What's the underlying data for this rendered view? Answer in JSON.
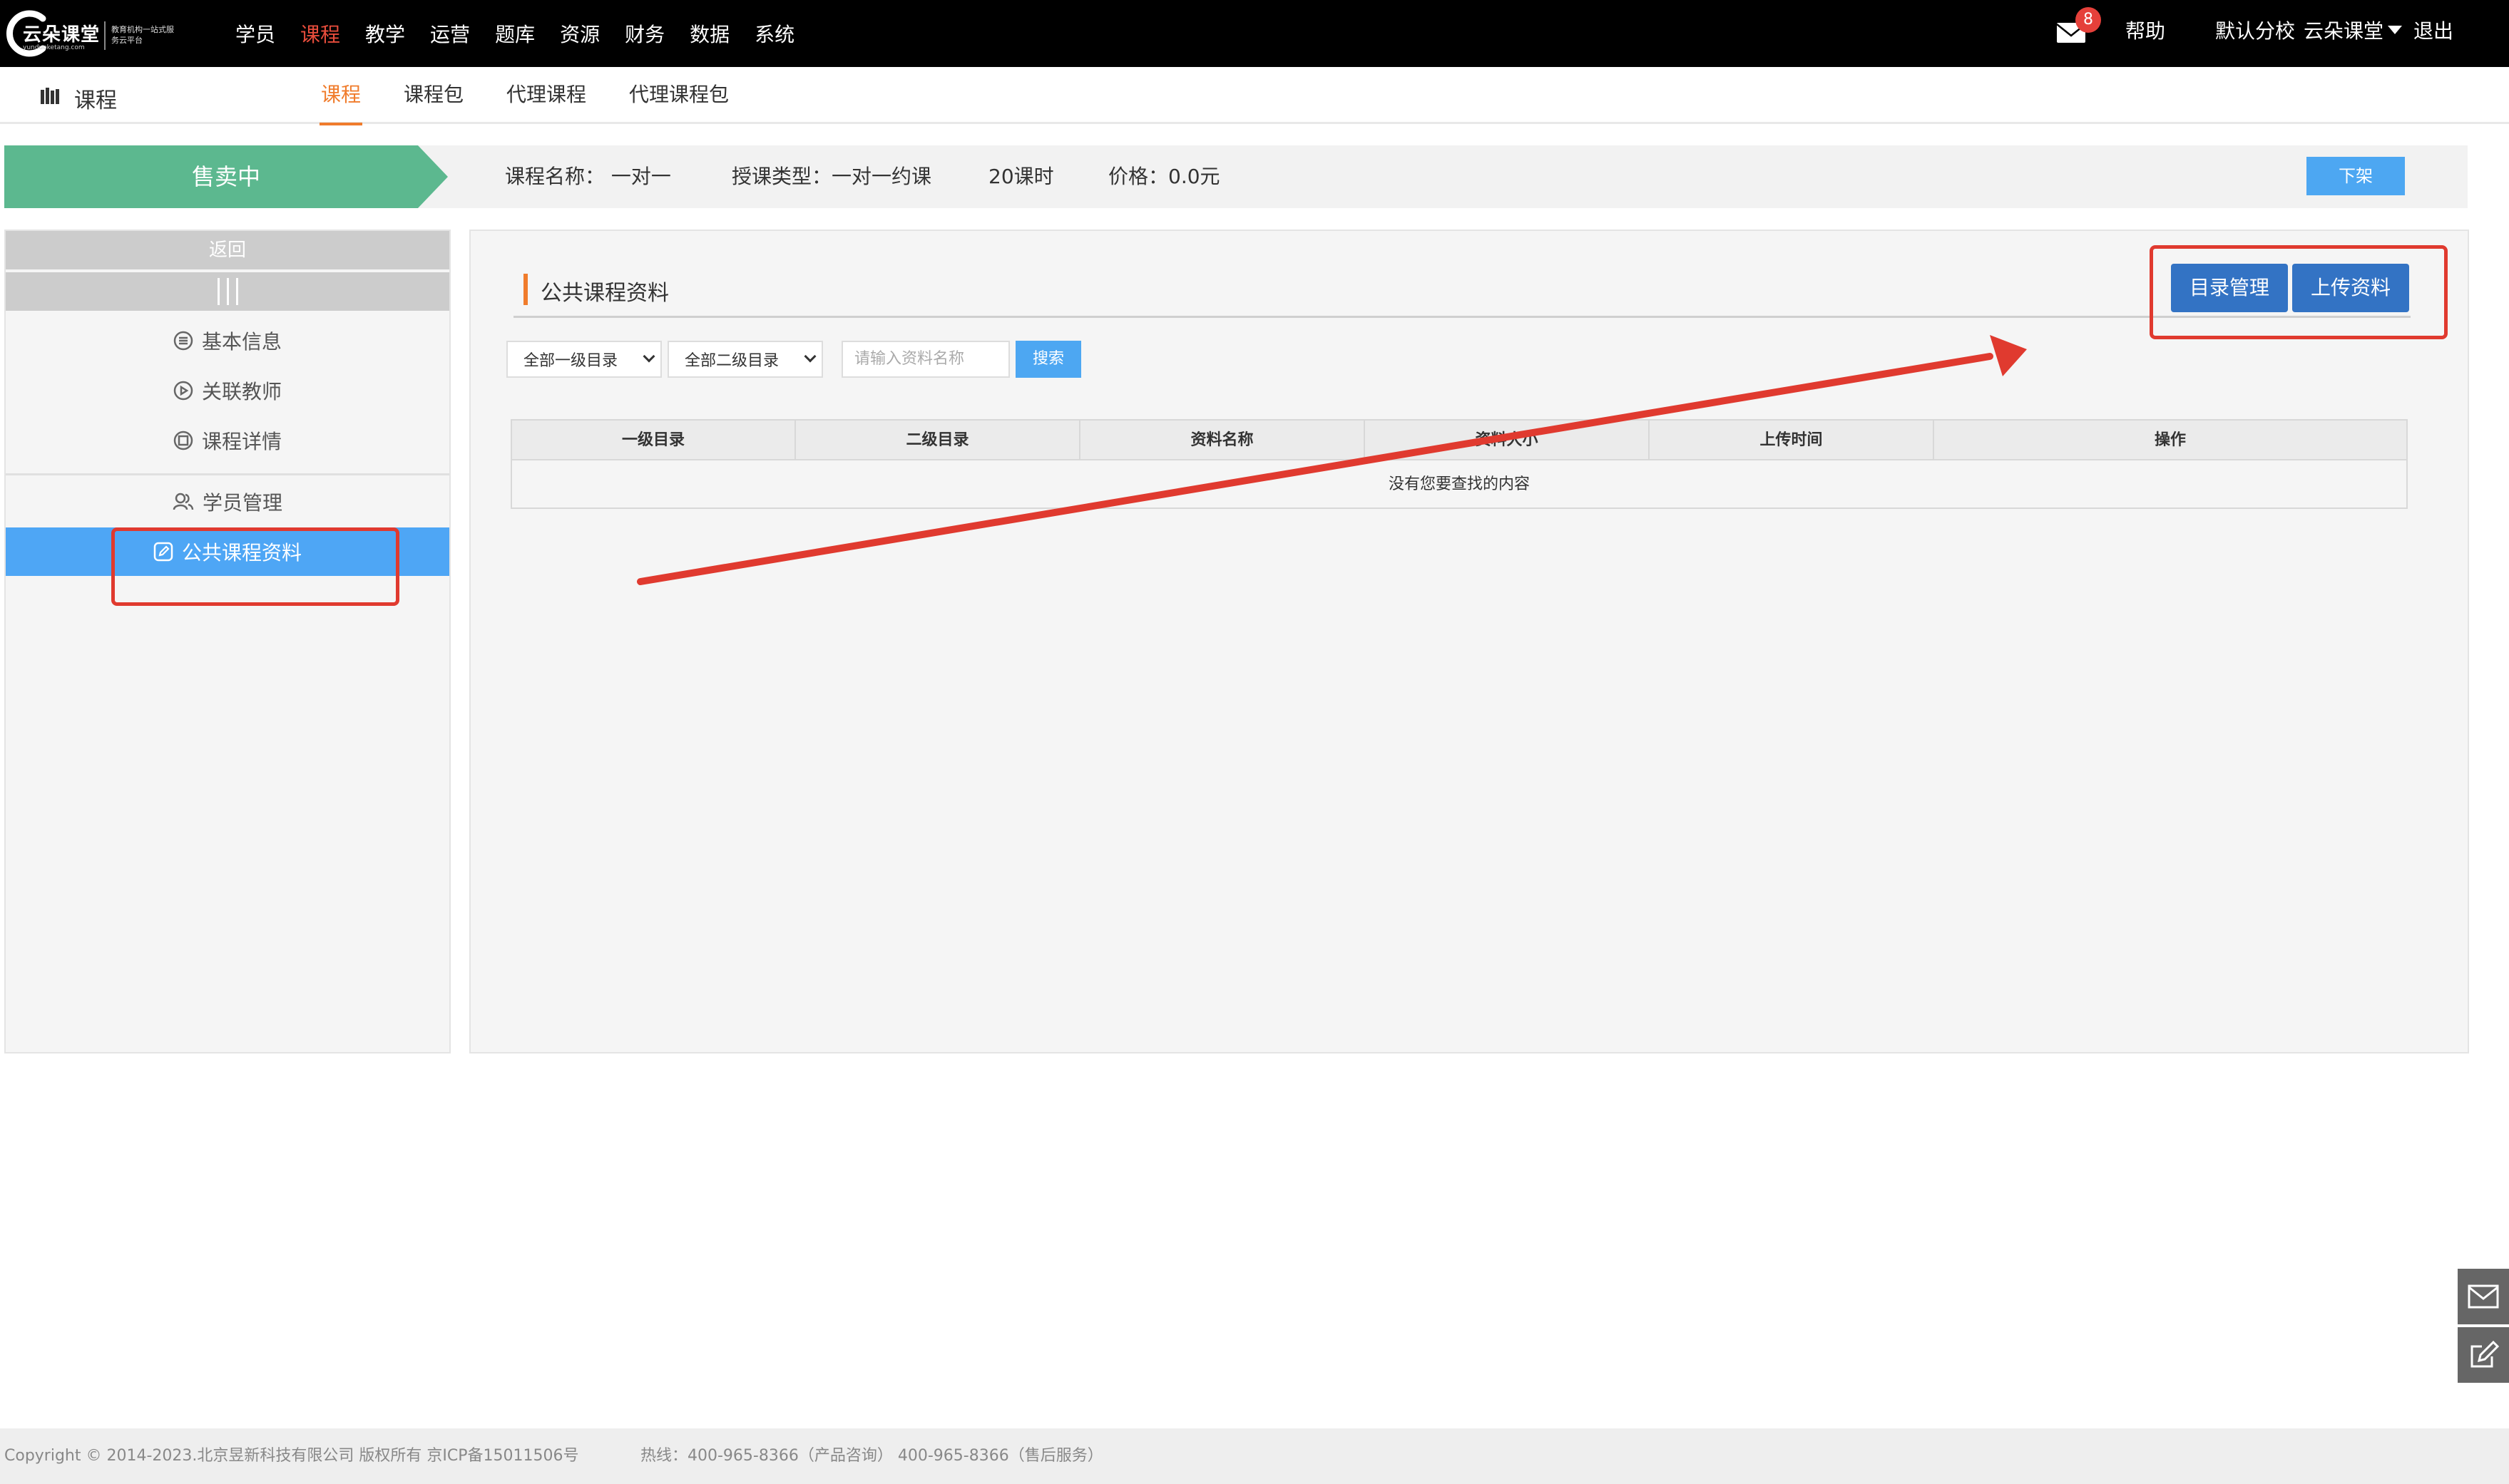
{
  "brand": {
    "name": "云朵课堂",
    "domain": "yunduoketang.com",
    "slogan": "教育机构一站式服务云平台"
  },
  "nav": {
    "items": [
      "学员",
      "课程",
      "教学",
      "运营",
      "题库",
      "资源",
      "财务",
      "数据",
      "系统"
    ],
    "active_index": 1
  },
  "header": {
    "mail_count": "8",
    "help_label": "帮助",
    "campus_label": "默认分校",
    "user_label": "云朵课堂",
    "logout_label": "退出"
  },
  "subheader": {
    "title": "课程",
    "tabs": [
      "课程",
      "课程包",
      "代理课程",
      "代理课程包"
    ],
    "active_tab": 0
  },
  "status": {
    "state_label": "售卖中",
    "course_name": "课程名称：  一对一",
    "teach_type": "授课类型：一对一约课",
    "hours": "20课时",
    "price": "价格：0.0元",
    "offshelf_label": "下架"
  },
  "sidebar": {
    "back_label": "返回",
    "items": [
      {
        "label": "基本信息",
        "icon": "list-icon"
      },
      {
        "label": "关联教师",
        "icon": "play-icon"
      },
      {
        "label": "课程详情",
        "icon": "detail-icon"
      },
      {
        "label": "学员管理",
        "icon": "users-icon"
      },
      {
        "label": "公共课程资料",
        "icon": "edit-icon",
        "active": true
      }
    ]
  },
  "main": {
    "section_title": "公共课程资料",
    "dir_manage_label": "目录管理",
    "upload_label": "上传资料",
    "filter": {
      "level1_value": "全部一级目录",
      "level2_value": "全部二级目录",
      "search_placeholder": "请输入资料名称",
      "search_label": "搜索"
    },
    "table": {
      "columns": [
        "一级目录",
        "二级目录",
        "资料名称",
        "资料大小",
        "上传时间",
        "操作"
      ],
      "empty_text": "没有您要查找的内容"
    }
  },
  "footer": {
    "copyright": "Copyright © 2014-2023.北京昱新科技有限公司 版权所有 京ICP备15011506号",
    "hotline": "热线：400-965-8366（产品咨询） 400-965-8366（售后服务）"
  },
  "colors": {
    "accent_orange": "#f07c2c",
    "nav_active": "#e84d3c",
    "status_green": "#5cb88f",
    "primary_blue": "#3373c4",
    "light_blue": "#4da7f2",
    "annotation_red": "#e03a2f"
  }
}
